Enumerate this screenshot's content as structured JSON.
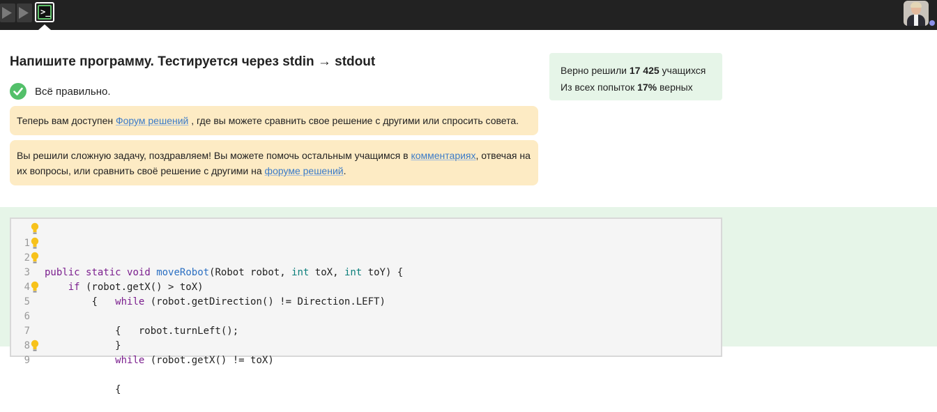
{
  "topbar": {
    "step_icons": [
      "play-icon",
      "play-icon",
      "terminal-icon"
    ],
    "active_step_glyph": "≡"
  },
  "task": {
    "title": "Напишите программу. Тестируется через stdin → stdout",
    "status_text": "Всё правильно."
  },
  "notes": {
    "forum": {
      "before": "Теперь вам доступен ",
      "link": "Форум решений",
      "after": " , где вы можете сравнить свое решение с другими или спросить совета."
    },
    "hard_task": {
      "part1": "Вы решили сложную задачу, поздравляем! Вы можете помочь остальным учащимся в ",
      "link1": "комментариях",
      "part2": ", отвечая на их вопросы, или сравнить своё решение с другими на ",
      "link2": "форуме решений",
      "part3": "."
    }
  },
  "stats": {
    "solved_prefix": "Верно решили ",
    "solved_count": "17 425",
    "solved_suffix": " учащихся",
    "rate_prefix": "Из всех попыток ",
    "rate_value": "17%",
    "rate_suffix": " верных"
  },
  "code": {
    "lines": [
      {
        "n": "1",
        "bulb": true
      },
      {
        "n": "2",
        "bulb": true
      },
      {
        "n": "3",
        "bulb": true
      },
      {
        "n": "4",
        "bulb": false
      },
      {
        "n": "5",
        "bulb": true
      },
      {
        "n": "6",
        "bulb": false
      },
      {
        "n": "7",
        "bulb": false
      },
      {
        "n": "8",
        "bulb": false
      },
      {
        "n": "9",
        "bulb": true
      }
    ],
    "tokens": {
      "l1_public": "public",
      "l1_static": "static",
      "l1_void": "void",
      "l1_fn": "moveRobot",
      "l1_a": "(Robot robot, ",
      "l1_int1": "int",
      "l1_b": " toX, ",
      "l1_int2": "int",
      "l1_c": " toY) {",
      "l2_if": "if",
      "l2_rest": " (robot.getX() > toX)",
      "l3": "{",
      "l4_while": "while",
      "l4_rest": " (robot.getDirection() != Direction.LEFT)",
      "l5": "{",
      "l6": "robot.turnLeft();",
      "l7": "}",
      "l8_while": "while",
      "l8_rest": " (robot.getX() != toX)",
      "l9": "{"
    }
  },
  "colors": {
    "topbar": "#222222",
    "note_bg": "#fdebc4",
    "stats_bg": "#e6f5e8",
    "success": "#53c06a",
    "link": "#3b7bc8",
    "keyword": "#7b1f8e",
    "function": "#2b6fc2",
    "type": "#0b7f7b"
  }
}
